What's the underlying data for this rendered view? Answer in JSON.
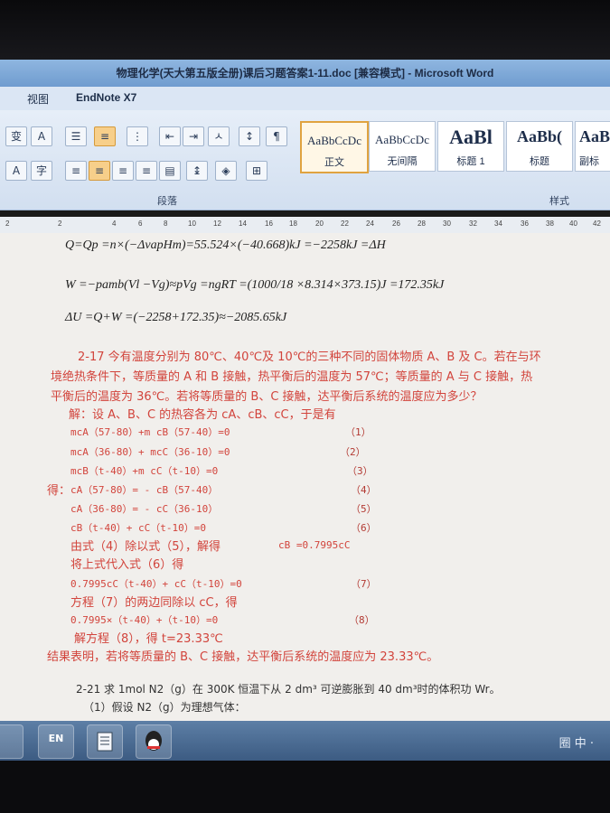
{
  "window": {
    "title": "物理化学(天大第五版全册)课后习题答案1-11.doc [兼容模式] - Microsoft Word"
  },
  "menu": {
    "items": [
      "视图",
      "EndNote X7"
    ]
  },
  "ribbon": {
    "paragraph_group_label": "段落",
    "styles_group_label": "样式",
    "styles": [
      {
        "sample": "AaBbCcDc",
        "name": "正文"
      },
      {
        "sample": "AaBbCcDc",
        "name": "无间隔"
      },
      {
        "sample": "AaBl",
        "name": "标题 1"
      },
      {
        "sample": "AaBb(",
        "name": "标题"
      },
      {
        "sample": "AaB",
        "name": "副标"
      }
    ],
    "font_buttons": [
      "变",
      "A",
      "A",
      "字"
    ]
  },
  "ruler": {
    "ticks": [
      "2",
      "2",
      "4",
      "6",
      "8",
      "10",
      "12",
      "14",
      "16",
      "18",
      "20",
      "22",
      "24",
      "26",
      "28",
      "30",
      "32",
      "34",
      "36",
      "38",
      "40",
      "42"
    ]
  },
  "document": {
    "eq1": "Q=Qp =n×(−ΔvapHm)=55.524×(−40.668)kJ =−2258kJ =ΔH",
    "eq2": "W =−pamb(Vl −Vg)≈pVg =ngRT =(1000/18 ×8.314×373.15)J =172.35kJ",
    "eq3": "ΔU =Q+W =(−2258+172.35)≈−2085.65kJ",
    "problem_217_l1": "2-17 今有温度分别为 80℃、40℃及 10℃的三种不同的固体物质 A、B 及 C。若在与环",
    "problem_217_l2": "境绝热条件下，等质量的 A 和 B 接触，热平衡后的温度为 57℃；等质量的 A 与 C 接触，热",
    "problem_217_l3": "平衡后的温度为 36℃。若将等质量的 B、C 接触，达平衡后系统的温度应为多少？",
    "sol_intro": "解：设 A、B、C 的热容各为 cA、cB、cC，于是有",
    "eqs": [
      {
        "text": "mcA（57-80）+m cB（57-40）=0",
        "num": "（1）"
      },
      {
        "text": "mcA（36-80）+ mcC（36-10）=0",
        "num": "（2）"
      },
      {
        "text": "mcB（t-40）+m cC（t-10）=0",
        "num": "（3）"
      },
      {
        "text": "cA（57-80）= - cB（57-40）",
        "num": "（4）"
      },
      {
        "text": "cA（36-80）= - cC（36-10）",
        "num": "（5）"
      },
      {
        "text": "cB（t-40）+ cC（t-10）=0",
        "num": "（6）"
      }
    ],
    "de_label": "得：",
    "step_divide": "由式（4）除以式（5），解得",
    "step_divide_result": "cB =0.7995cC",
    "step_substitute": "将上式代入式（6）得",
    "eq7": {
      "text": "0.7995cC（t-40）+ cC（t-10）=0",
      "num": "（7）"
    },
    "step_cancel": "方程（7）的两边同除以 cC，得",
    "eq8": {
      "text": "0.7995×（t-40）+（t-10）=0",
      "num": "（8）"
    },
    "step_solve": "解方程（8），得    t=23.33℃",
    "conclusion": "结果表明，若将等质量的 B、C 接触，达平衡后系统的温度应为 23.33℃。",
    "problem_221": "2-21  求 1mol N2（g）在 300K 恒温下从 2 dm³ 可逆膨胀到 40 dm³时的体积功 Wr。",
    "problem_221_sub": "（1）假设 N2（g）为理想气体："
  },
  "taskbar": {
    "items": [
      "EN",
      "word-icon",
      "qq-icon"
    ],
    "tray_text": "圈 中 ·"
  },
  "colors": {
    "problem_text": "#d2443c",
    "title_bar": "#7fa8d8",
    "page_bg": "#f1efec"
  }
}
